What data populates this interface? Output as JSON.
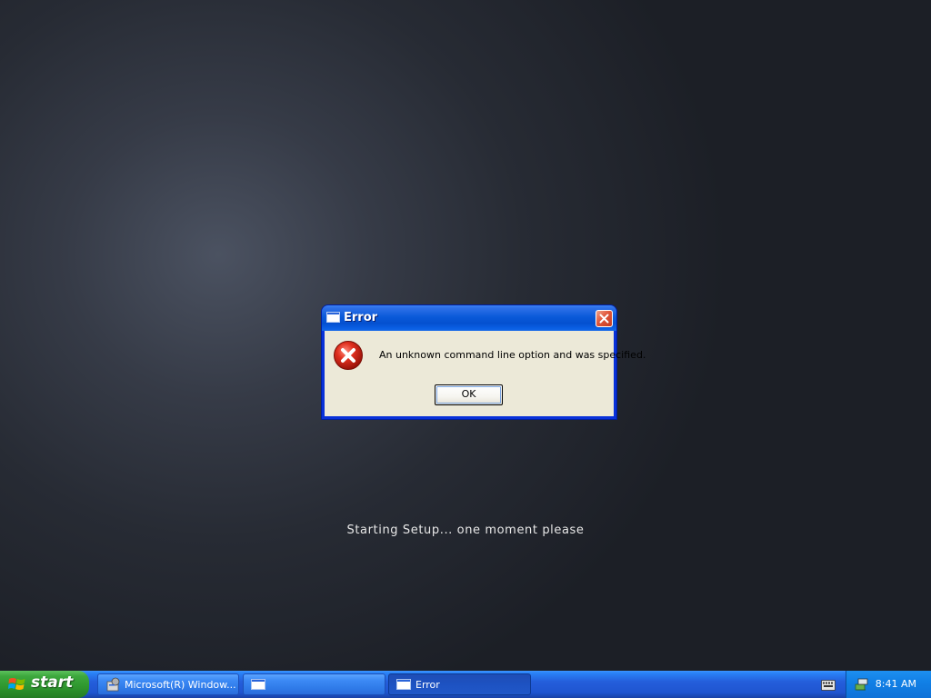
{
  "desktop": {
    "status_text": "Starting Setup... one moment please"
  },
  "dialog": {
    "title": "Error",
    "message": "An unknown command line option and was specified.",
    "ok_label": "OK",
    "icon": "error-icon"
  },
  "taskbar": {
    "start_label": "start",
    "tasks": [
      {
        "label": "Microsoft(R) Window...",
        "icon": "setup-icon",
        "active": false
      },
      {
        "label": "",
        "icon": "window-icon",
        "active": false
      },
      {
        "label": "Error",
        "icon": "window-icon",
        "active": true
      }
    ],
    "tray": {
      "clock": "8:41 AM"
    }
  },
  "colors": {
    "titlebar": "#0a5ad9",
    "dialog_body": "#ece9d8",
    "taskbar": "#245edb",
    "start_button": "#3da83d",
    "error_red": "#d9261c"
  }
}
